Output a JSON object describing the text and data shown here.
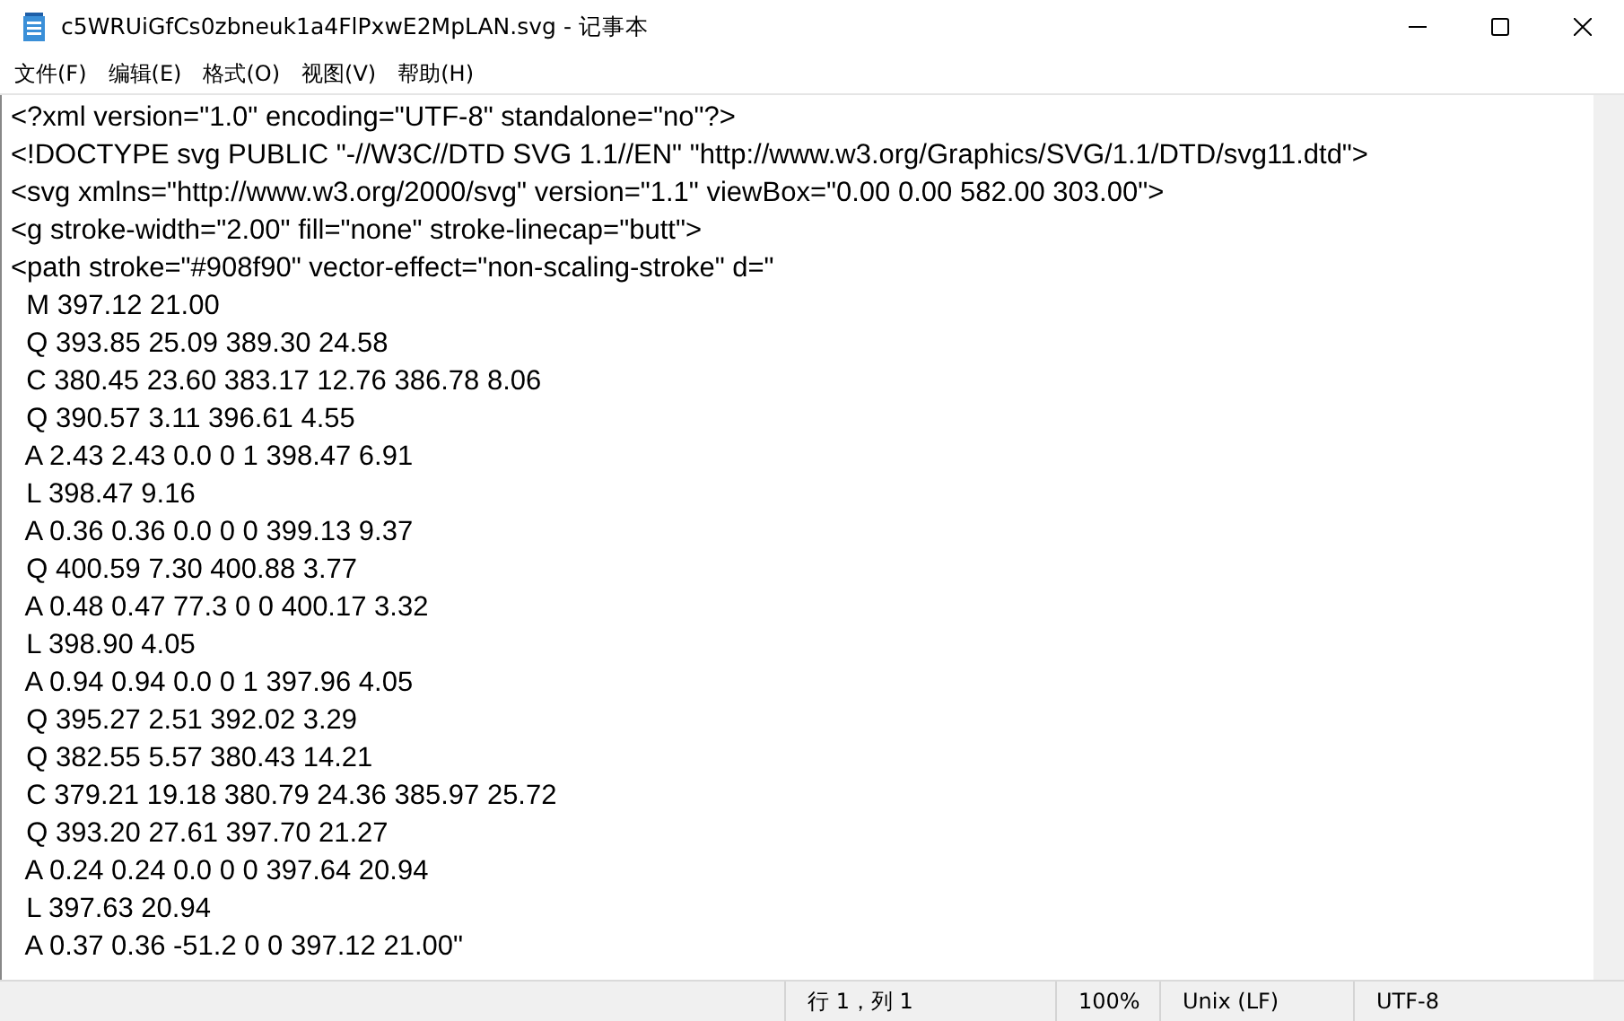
{
  "window": {
    "title": "c5WRUiGfCs0zbneuk1a4FlPxwE2MpLAN.svg - 记事本"
  },
  "menu": [
    "文件(F)",
    "编辑(E)",
    "格式(O)",
    "视图(V)",
    "帮助(H)"
  ],
  "editor": {
    "lines": [
      "<?xml version=\"1.0\" encoding=\"UTF-8\" standalone=\"no\"?>",
      "<!DOCTYPE svg PUBLIC \"-//W3C//DTD SVG 1.1//EN\" \"http://www.w3.org/Graphics/SVG/1.1/DTD/svg11.dtd\">",
      "<svg xmlns=\"http://www.w3.org/2000/svg\" version=\"1.1\" viewBox=\"0.00 0.00 582.00 303.00\">",
      "<g stroke-width=\"2.00\" fill=\"none\" stroke-linecap=\"butt\">",
      "<path stroke=\"#908f90\" vector-effect=\"non-scaling-stroke\" d=\"",
      "  M 397.12 21.00",
      "  Q 393.85 25.09 389.30 24.58",
      "  C 380.45 23.60 383.17 12.76 386.78 8.06",
      "  Q 390.57 3.11 396.61 4.55",
      "  A 2.43 2.43 0.0 0 1 398.47 6.91",
      "  L 398.47 9.16",
      "  A 0.36 0.36 0.0 0 0 399.13 9.37",
      "  Q 400.59 7.30 400.88 3.77",
      "  A 0.48 0.47 77.3 0 0 400.17 3.32",
      "  L 398.90 4.05",
      "  A 0.94 0.94 0.0 0 1 397.96 4.05",
      "  Q 395.27 2.51 392.02 3.29",
      "  Q 382.55 5.57 380.43 14.21",
      "  C 379.21 19.18 380.79 24.36 385.97 25.72",
      "  Q 393.20 27.61 397.70 21.27",
      "  A 0.24 0.24 0.0 0 0 397.64 20.94",
      "  L 397.63 20.94",
      "  A 0.37 0.36 -51.2 0 0 397.12 21.00\""
    ]
  },
  "status_bar": {
    "position": "行 1，列 1",
    "zoom": "100%",
    "line_ending": "Unix (LF)",
    "encoding": "UTF-8"
  }
}
